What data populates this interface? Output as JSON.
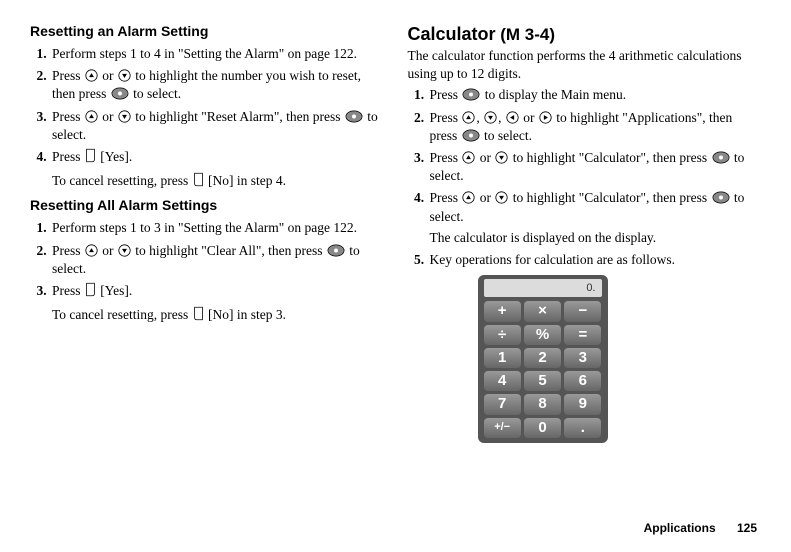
{
  "left": {
    "h1": "Resetting an Alarm Setting",
    "s1_1": "Perform steps 1 to 4 in \"Setting the Alarm\" on page 122.",
    "s1_2a": "Press ",
    "s1_2b": " or ",
    "s1_2c": " to highlight the number you wish to reset, then press ",
    "s1_2d": " to select.",
    "s1_3a": "Press ",
    "s1_3b": " or ",
    "s1_3c": " to highlight \"Reset Alarm\", then press ",
    "s1_3d": " to select.",
    "s1_4a": "Press ",
    "s1_4b": " [Yes].",
    "s1_4after_a": "To cancel resetting, press ",
    "s1_4after_b": " [No] in step 4.",
    "h2": "Resetting All Alarm Settings",
    "s2_1": "Perform steps 1 to 3 in \"Setting the Alarm\" on page 122.",
    "s2_2a": "Press ",
    "s2_2b": " or ",
    "s2_2c": " to highlight \"Clear All\", then press ",
    "s2_2d": " to select.",
    "s2_3a": "Press ",
    "s2_3b": " [Yes].",
    "s2_3after_a": "To cancel resetting, press ",
    "s2_3after_b": " [No] in step 3."
  },
  "right": {
    "h1": "Calculator",
    "mcode": " (M 3-4)",
    "intro": "The calculator function performs the 4 arithmetic calculations using up to 12 digits.",
    "r1a": "Press ",
    "r1b": " to display the Main menu.",
    "r2a": "Press ",
    "r2b": ", ",
    "r2c": ", ",
    "r2d": " or ",
    "r2e": " to highlight \"Applications\", then press ",
    "r2f": " to select.",
    "r3a": "Press ",
    "r3b": " or ",
    "r3c": " to highlight \"Calculator\", then press ",
    "r3d": " to select.",
    "r4a": "Press ",
    "r4b": " or ",
    "r4c": " to highlight \"Calculator\", then press ",
    "r4d": " to select.",
    "r4after": "The calculator is displayed on the display.",
    "r5": "Key operations for calculation are as follows."
  },
  "keypad": [
    "+",
    "×",
    "−",
    "÷",
    "%",
    "=",
    "1",
    "2",
    "3",
    "4",
    "5",
    "6",
    "7",
    "8",
    "9",
    "+/−",
    "0",
    "."
  ],
  "footer": {
    "label": "Applications",
    "page": "125"
  }
}
